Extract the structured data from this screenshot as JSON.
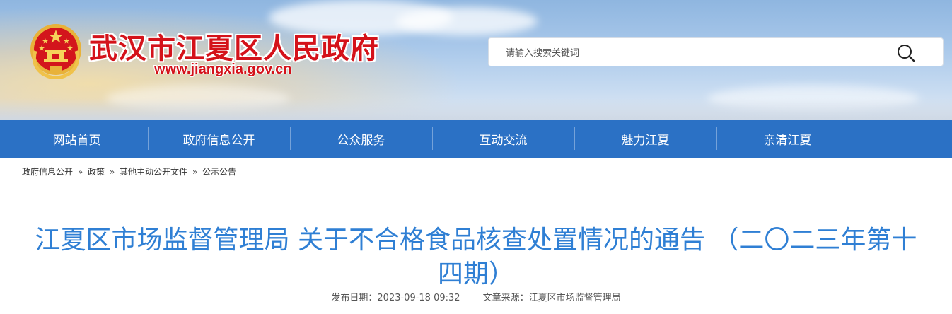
{
  "header": {
    "site_title": "武汉市江夏区人民政府",
    "site_url": "www.jiangxia.gov.cn",
    "emblem_icon": "national-emblem-icon",
    "search": {
      "placeholder": "请输入搜索关键词",
      "value": "",
      "button_icon": "search-icon"
    }
  },
  "nav": {
    "items": [
      {
        "label": "网站首页"
      },
      {
        "label": "政府信息公开"
      },
      {
        "label": "公众服务"
      },
      {
        "label": "互动交流"
      },
      {
        "label": "魅力江夏"
      },
      {
        "label": "亲清江夏"
      }
    ]
  },
  "breadcrumb": {
    "items": [
      {
        "label": "政府信息公开"
      },
      {
        "label": "政策"
      },
      {
        "label": "其他主动公开文件"
      },
      {
        "label": "公示公告"
      }
    ],
    "separator": "»"
  },
  "article": {
    "title": "江夏区市场监督管理局 关于不合格食品核查处置情况的通告 （二〇二三年第十四期）",
    "publish_label": "发布日期：",
    "publish_date": "2023-09-18 09:32",
    "source_label": "文章来源：",
    "source": "江夏区市场监督管理局"
  },
  "colors": {
    "nav_bg": "#2b71c5",
    "title_red": "#d4121a",
    "article_title_blue": "#2f7fd4"
  }
}
